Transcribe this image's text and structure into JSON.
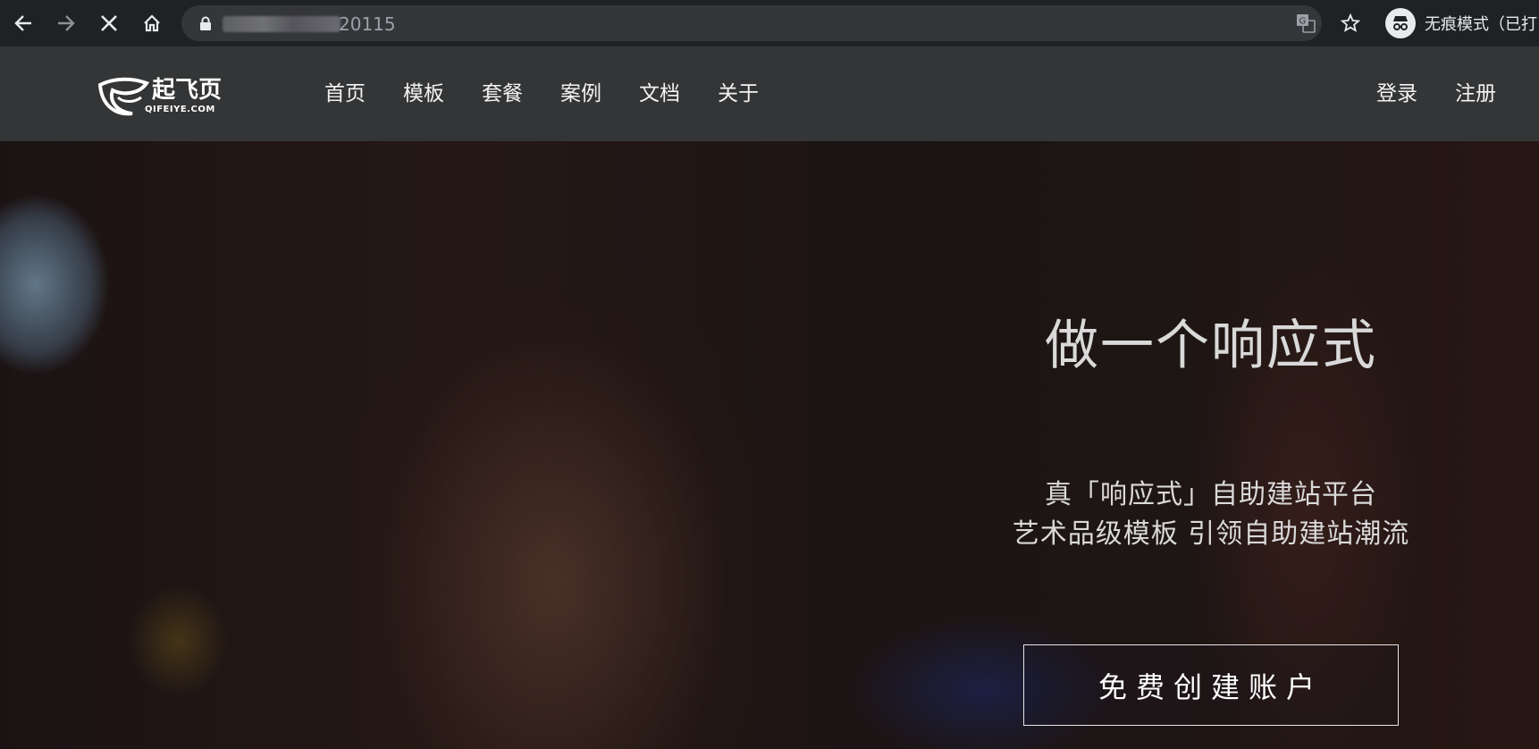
{
  "browser": {
    "url_visible": "20115",
    "profile_label": "无痕模式（已打"
  },
  "site": {
    "logo_text": "起飞页",
    "logo_sub": "QIFEIYE.COM",
    "menu": [
      "首页",
      "模板",
      "套餐",
      "案例",
      "文档",
      "关于"
    ],
    "auth": {
      "login": "登录",
      "register": "注册"
    },
    "hero": {
      "title": "做一个响应式",
      "subtitle_line1": "真「响应式」自助建站平台",
      "subtitle_line2": "艺术品级模板 引领自助建站潮流",
      "cta": "免费创建账户"
    }
  },
  "colors": {
    "chrome_bg": "#202124",
    "omnibox_bg": "#35363a",
    "nav_bg": "#343536",
    "text": "#f2f2f2"
  },
  "icons": [
    "back-arrow-icon",
    "forward-arrow-icon",
    "stop-loading-icon",
    "home-icon",
    "lock-icon",
    "translate-icon",
    "star-icon",
    "incognito-icon"
  ]
}
